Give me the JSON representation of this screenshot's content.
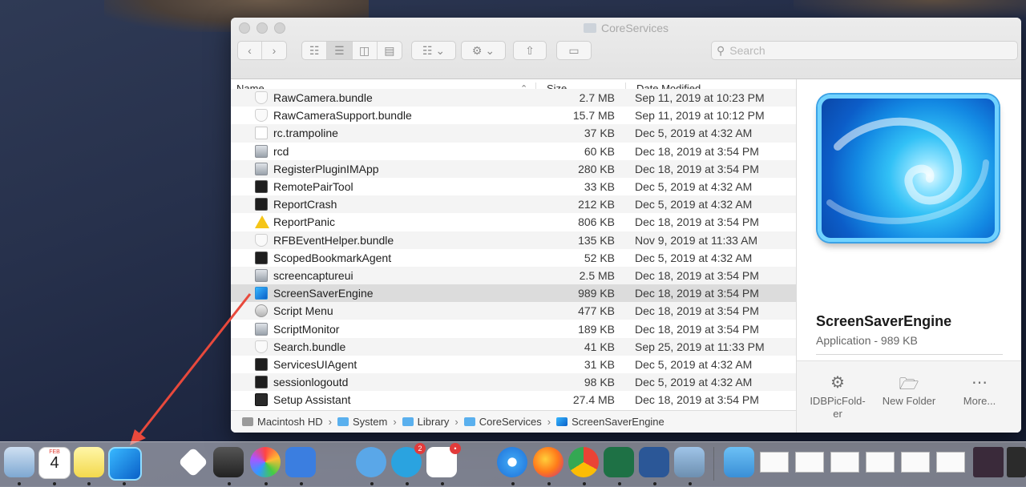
{
  "window": {
    "title": "CoreServices",
    "search_placeholder": "Search"
  },
  "columns": {
    "name": "Name",
    "size": "Size",
    "date": "Date Modified"
  },
  "files": [
    {
      "name": "RawCamera.bundle",
      "size": "2.7 MB",
      "date": "Sep 11, 2019 at 10:23 PM",
      "icon": "bundle"
    },
    {
      "name": "RawCameraSupport.bundle",
      "size": "15.7 MB",
      "date": "Sep 11, 2019 at 10:12 PM",
      "icon": "bundle"
    },
    {
      "name": "rc.trampoline",
      "size": "37 KB",
      "date": "Dec 5, 2019 at 4:32 AM",
      "icon": "doc"
    },
    {
      "name": "rcd",
      "size": "60 KB",
      "date": "Dec 18, 2019 at 3:54 PM",
      "icon": "app"
    },
    {
      "name": "RegisterPluginIMApp",
      "size": "280 KB",
      "date": "Dec 18, 2019 at 3:54 PM",
      "icon": "app"
    },
    {
      "name": "RemotePairTool",
      "size": "33 KB",
      "date": "Dec 5, 2019 at 4:32 AM",
      "icon": "term"
    },
    {
      "name": "ReportCrash",
      "size": "212 KB",
      "date": "Dec 5, 2019 at 4:32 AM",
      "icon": "term"
    },
    {
      "name": "ReportPanic",
      "size": "806 KB",
      "date": "Dec 18, 2019 at 3:54 PM",
      "icon": "warn"
    },
    {
      "name": "RFBEventHelper.bundle",
      "size": "135 KB",
      "date": "Nov 9, 2019 at 11:33 AM",
      "icon": "bundle"
    },
    {
      "name": "ScopedBookmarkAgent",
      "size": "52 KB",
      "date": "Dec 5, 2019 at 4:32 AM",
      "icon": "term"
    },
    {
      "name": "screencaptureui",
      "size": "2.5 MB",
      "date": "Dec 18, 2019 at 3:54 PM",
      "icon": "app"
    },
    {
      "name": "ScreenSaverEngine",
      "size": "989 KB",
      "date": "Dec 18, 2019 at 3:54 PM",
      "icon": "ss"
    },
    {
      "name": "Script Menu",
      "size": "477 KB",
      "date": "Dec 18, 2019 at 3:54 PM",
      "icon": "script"
    },
    {
      "name": "ScriptMonitor",
      "size": "189 KB",
      "date": "Dec 18, 2019 at 3:54 PM",
      "icon": "app"
    },
    {
      "name": "Search.bundle",
      "size": "41 KB",
      "date": "Sep 25, 2019 at 11:33 PM",
      "icon": "bundle"
    },
    {
      "name": "ServicesUIAgent",
      "size": "31 KB",
      "date": "Dec 5, 2019 at 4:32 AM",
      "icon": "term"
    },
    {
      "name": "sessionlogoutd",
      "size": "98 KB",
      "date": "Dec 5, 2019 at 4:32 AM",
      "icon": "term"
    },
    {
      "name": "Setup Assistant",
      "size": "27.4 MB",
      "date": "Dec 18, 2019 at 3:54 PM",
      "icon": "setup"
    }
  ],
  "selected_file": "ScreenSaverEngine",
  "path": [
    "Macintosh HD",
    "System",
    "Library",
    "CoreServices",
    "ScreenSaverEngine"
  ],
  "preview": {
    "name": "ScreenSaverEngine",
    "kind": "Application - 989 KB",
    "actions": [
      {
        "label": "IDBPicFolder",
        "icon": "gear-icon"
      },
      {
        "label": "New Folder",
        "icon": "folder-icon"
      },
      {
        "label": "More...",
        "icon": "more-icon"
      }
    ]
  },
  "dock": {
    "calendar_month": "FEB",
    "calendar_day": "4",
    "telegram_badge": "2"
  }
}
